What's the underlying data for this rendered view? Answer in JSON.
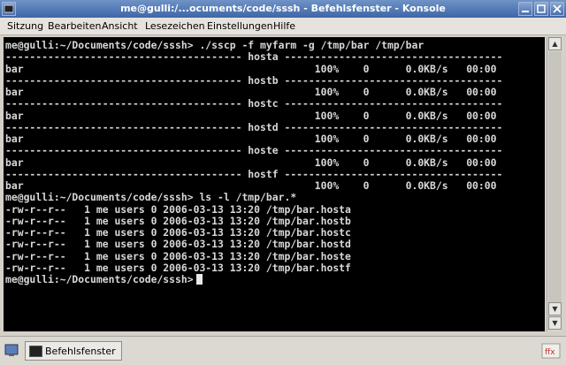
{
  "window": {
    "title": "me@gulli:/...ocuments/code/sssh - Befehlsfenster - Konsole"
  },
  "menu": [
    "Sitzung",
    "Bearbeiten",
    "Ansicht",
    "Lesezeichen",
    "Einstellungen",
    "Hilfe"
  ],
  "terminal": {
    "lines": [
      "me@gulli:~/Documents/code/sssh> ./sscp -f myfarm -g /tmp/bar /tmp/bar",
      "--------------------------------------- hosta ------------------------------------",
      "bar                                                100%    0      0.0KB/s   00:00",
      "--------------------------------------- hostb ------------------------------------",
      "bar                                                100%    0      0.0KB/s   00:00",
      "--------------------------------------- hostc ------------------------------------",
      "bar                                                100%    0      0.0KB/s   00:00",
      "--------------------------------------- hostd ------------------------------------",
      "bar                                                100%    0      0.0KB/s   00:00",
      "--------------------------------------- hoste ------------------------------------",
      "bar                                                100%    0      0.0KB/s   00:00",
      "--------------------------------------- hostf ------------------------------------",
      "bar                                                100%    0      0.0KB/s   00:00",
      "me@gulli:~/Documents/code/sssh> ls -l /tmp/bar.*",
      "-rw-r--r--   1 me users 0 2006-03-13 13:20 /tmp/bar.hosta",
      "-rw-r--r--   1 me users 0 2006-03-13 13:20 /tmp/bar.hostb",
      "-rw-r--r--   1 me users 0 2006-03-13 13:20 /tmp/bar.hostc",
      "-rw-r--r--   1 me users 0 2006-03-13 13:20 /tmp/bar.hostd",
      "-rw-r--r--   1 me users 0 2006-03-13 13:20 /tmp/bar.hoste",
      "-rw-r--r--   1 me users 0 2006-03-13 13:20 /tmp/bar.hostf"
    ],
    "prompt": "me@gulli:~/Documents/code/sssh>"
  },
  "taskbar": {
    "task_label": "Befehlsfenster"
  },
  "colors": {
    "titlebar": "#3d66a8",
    "terminal_bg": "#000000",
    "terminal_fg": "#d8d8d8"
  }
}
